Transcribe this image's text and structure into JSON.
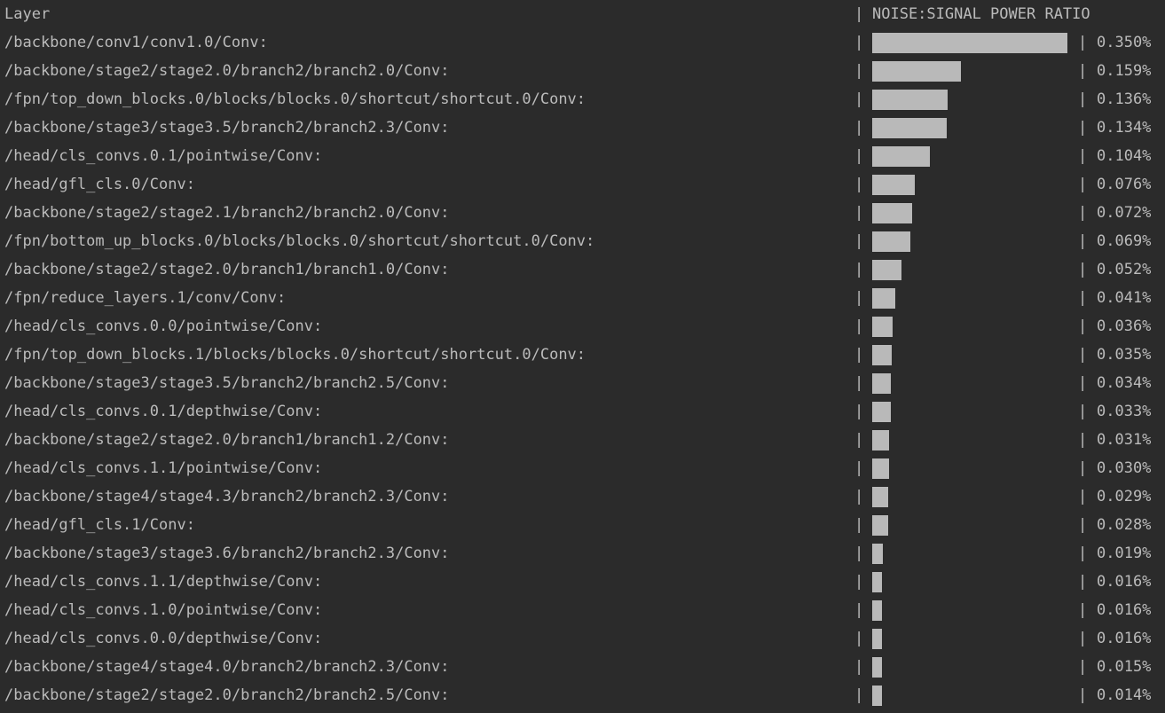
{
  "header": {
    "layer_label": "Layer",
    "separator": "|",
    "metric_label": "NOISE:SIGNAL POWER RATIO"
  },
  "rows": [
    {
      "layer": "/backbone/conv1/conv1.0/Conv:",
      "value": "0.350%",
      "ratio": 0.35
    },
    {
      "layer": "/backbone/stage2/stage2.0/branch2/branch2.0/Conv:",
      "value": "0.159%",
      "ratio": 0.159
    },
    {
      "layer": "/fpn/top_down_blocks.0/blocks/blocks.0/shortcut/shortcut.0/Conv:",
      "value": "0.136%",
      "ratio": 0.136
    },
    {
      "layer": "/backbone/stage3/stage3.5/branch2/branch2.3/Conv:",
      "value": "0.134%",
      "ratio": 0.134
    },
    {
      "layer": "/head/cls_convs.0.1/pointwise/Conv:",
      "value": "0.104%",
      "ratio": 0.104
    },
    {
      "layer": "/head/gfl_cls.0/Conv:",
      "value": "0.076%",
      "ratio": 0.076
    },
    {
      "layer": "/backbone/stage2/stage2.1/branch2/branch2.0/Conv:",
      "value": "0.072%",
      "ratio": 0.072
    },
    {
      "layer": "/fpn/bottom_up_blocks.0/blocks/blocks.0/shortcut/shortcut.0/Conv:",
      "value": "0.069%",
      "ratio": 0.069
    },
    {
      "layer": "/backbone/stage2/stage2.0/branch1/branch1.0/Conv:",
      "value": "0.052%",
      "ratio": 0.052
    },
    {
      "layer": "/fpn/reduce_layers.1/conv/Conv:",
      "value": "0.041%",
      "ratio": 0.041
    },
    {
      "layer": "/head/cls_convs.0.0/pointwise/Conv:",
      "value": "0.036%",
      "ratio": 0.036
    },
    {
      "layer": "/fpn/top_down_blocks.1/blocks/blocks.0/shortcut/shortcut.0/Conv:",
      "value": "0.035%",
      "ratio": 0.035
    },
    {
      "layer": "/backbone/stage3/stage3.5/branch2/branch2.5/Conv:",
      "value": "0.034%",
      "ratio": 0.034
    },
    {
      "layer": "/head/cls_convs.0.1/depthwise/Conv:",
      "value": "0.033%",
      "ratio": 0.033
    },
    {
      "layer": "/backbone/stage2/stage2.0/branch1/branch1.2/Conv:",
      "value": "0.031%",
      "ratio": 0.031
    },
    {
      "layer": "/head/cls_convs.1.1/pointwise/Conv:",
      "value": "0.030%",
      "ratio": 0.03
    },
    {
      "layer": "/backbone/stage4/stage4.3/branch2/branch2.3/Conv:",
      "value": "0.029%",
      "ratio": 0.029
    },
    {
      "layer": "/head/gfl_cls.1/Conv:",
      "value": "0.028%",
      "ratio": 0.028
    },
    {
      "layer": "/backbone/stage3/stage3.6/branch2/branch2.3/Conv:",
      "value": "0.019%",
      "ratio": 0.019
    },
    {
      "layer": "/head/cls_convs.1.1/depthwise/Conv:",
      "value": "0.016%",
      "ratio": 0.016
    },
    {
      "layer": "/head/cls_convs.1.0/pointwise/Conv:",
      "value": "0.016%",
      "ratio": 0.016
    },
    {
      "layer": "/head/cls_convs.0.0/depthwise/Conv:",
      "value": "0.016%",
      "ratio": 0.016
    },
    {
      "layer": "/backbone/stage4/stage4.0/branch2/branch2.3/Conv:",
      "value": "0.015%",
      "ratio": 0.015
    },
    {
      "layer": "/backbone/stage2/stage2.0/branch2/branch2.5/Conv:",
      "value": "0.014%",
      "ratio": 0.014
    }
  ],
  "bar_max_ratio": 0.35,
  "colors": {
    "background": "#2b2b2b",
    "text": "#bbbbbb",
    "bar": "#b9b9b9"
  }
}
